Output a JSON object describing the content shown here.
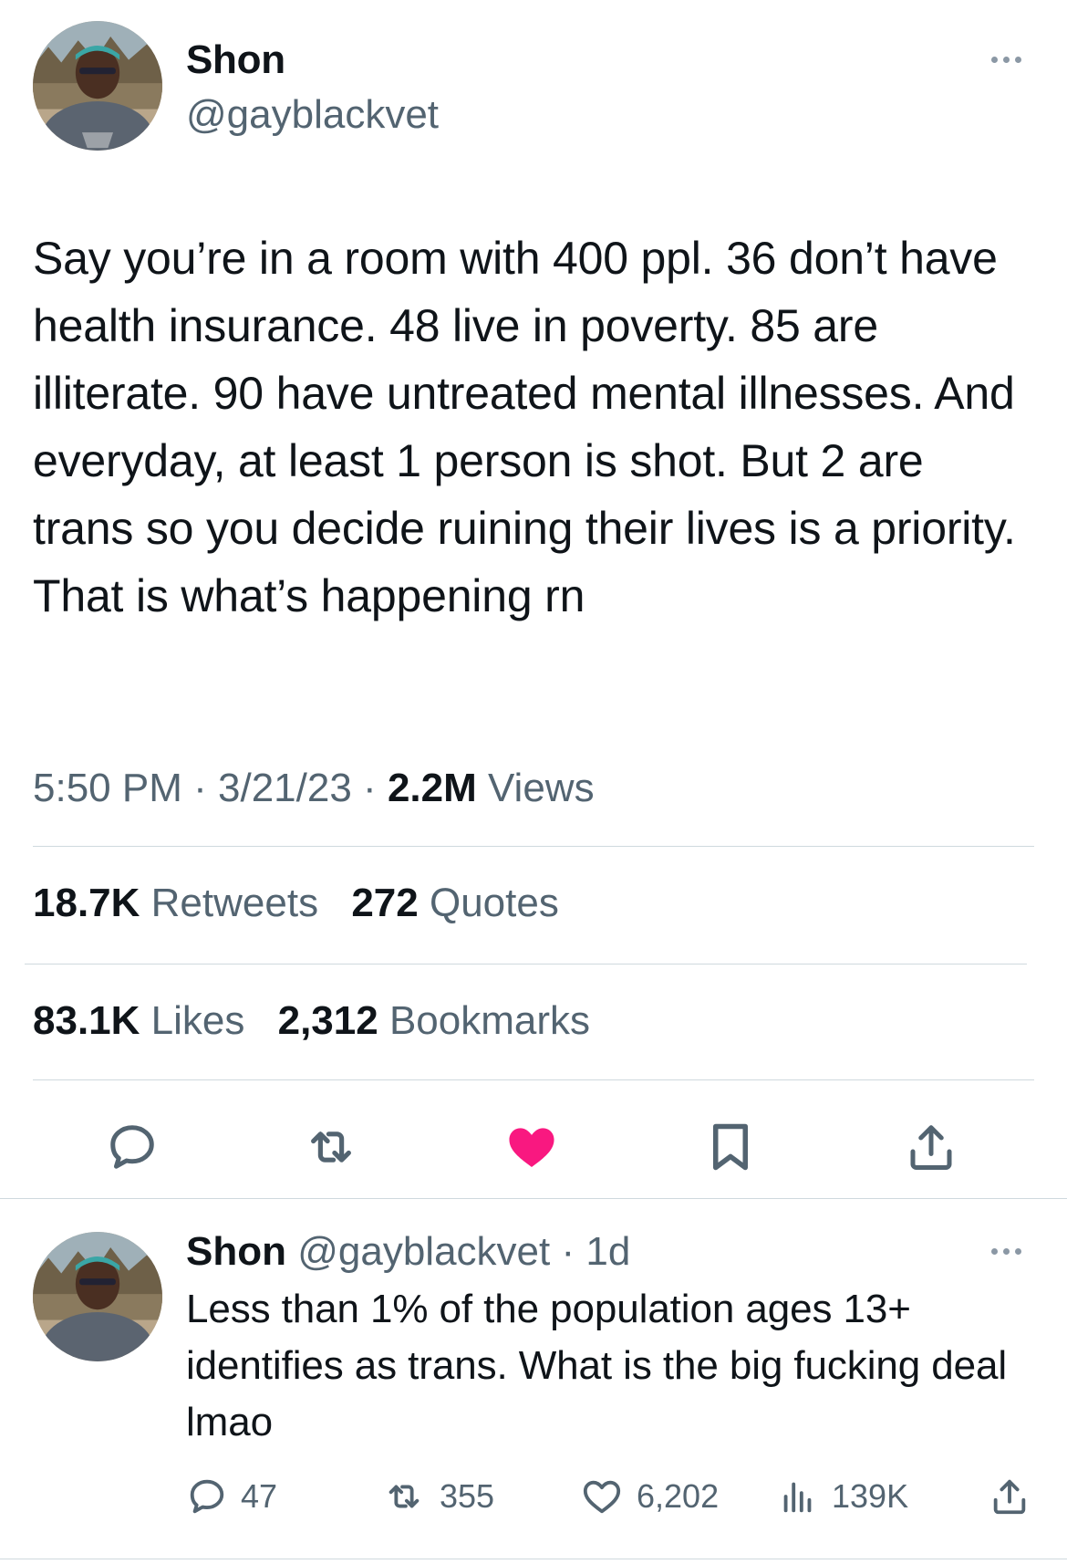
{
  "main_tweet": {
    "author_name": "Shon",
    "author_handle": "@gayblackvet",
    "text": "Say you’re in a room with 400 ppl. 36 don’t have health insurance. 48 live in poverty. 85 are illiterate. 90 have untreated mental illnesses. And everyday, at least 1 person is shot. But 2 are trans so you decide ruining their lives is a priority. That is what’s happening rn",
    "time": "5:50 PM",
    "separator": "·",
    "date": "3/21/23",
    "views_count": "2.2M",
    "views_label": "Views",
    "retweets_count": "18.7K",
    "retweets_label": "Retweets",
    "quotes_count": "272",
    "quotes_label": "Quotes",
    "likes_count": "83.1K",
    "likes_label": "Likes",
    "bookmarks_count": "2,312",
    "bookmarks_label": "Bookmarks",
    "liked": true
  },
  "reply_tweet": {
    "author_name": "Shon",
    "author_handle": "@gayblackvet",
    "separator": "·",
    "age": "1d",
    "text": "Less than 1% of the population ages 13+ identifies as trans. What is the big fucking deal lmao",
    "replies": "47",
    "retweets": "355",
    "likes": "6,202",
    "views": "139K"
  },
  "icons": {
    "more": "more-horizontal-icon",
    "reply": "speech-bubble-icon",
    "retweet": "retweet-arrows-icon",
    "like": "heart-icon",
    "bookmark": "bookmark-icon",
    "share": "share-upload-icon",
    "views": "bar-chart-icon"
  },
  "colors": {
    "text": "#0f1419",
    "secondary": "#536471",
    "divider": "#cfd9de",
    "like_active": "#f91880"
  }
}
